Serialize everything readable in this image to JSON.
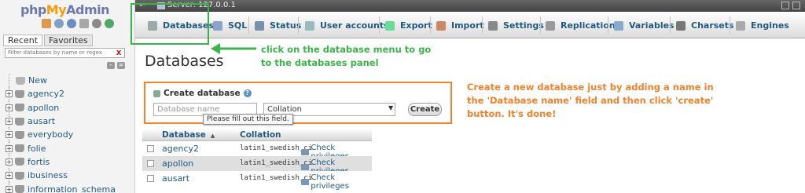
{
  "logo": {
    "part1": "php",
    "part2": "My",
    "part3": "Admin"
  },
  "nav": {
    "tabs": [
      "Recent",
      "Favorites"
    ],
    "filter_placeholder": "Filter databases by name or regex",
    "filter_clear": "X",
    "tree": [
      "New",
      "agency2",
      "apollon",
      "ausart",
      "everybody",
      "folie",
      "fortis",
      "ibusiness",
      "information_schema"
    ]
  },
  "topbar": {
    "back": "←",
    "server": "Server: 127.0.0.1"
  },
  "menu": {
    "tabs": [
      {
        "label": "Databases",
        "icon": "database-icon",
        "color": "#9aa"
      },
      {
        "label": "SQL",
        "icon": "sql-icon",
        "color": "#8aa4c8"
      },
      {
        "label": "Status",
        "icon": "status-icon",
        "color": "#7a8fa8"
      },
      {
        "label": "User accounts",
        "icon": "users-icon",
        "color": "#9bb"
      },
      {
        "label": "Export",
        "icon": "export-icon",
        "color": "#6d9"
      },
      {
        "label": "Import",
        "icon": "import-icon",
        "color": "#c86"
      },
      {
        "label": "Settings",
        "icon": "settings-icon",
        "color": "#888"
      },
      {
        "label": "Replication",
        "icon": "replication-icon",
        "color": "#999"
      },
      {
        "label": "Variables",
        "icon": "variables-icon",
        "color": "#8ac"
      },
      {
        "label": "Charsets",
        "icon": "charsets-icon",
        "color": "#777"
      },
      {
        "label": "Engines",
        "icon": "engines-icon",
        "color": "#aaa"
      }
    ]
  },
  "annotations": {
    "green": "click on the database menu to go to the databases panel",
    "orange": "Create a new database just by adding a name in the 'Database name' field and then click 'create' button. It's done!"
  },
  "page_title": "Databases",
  "create": {
    "heading": "Create database",
    "name_placeholder": "Database name",
    "collation": "Collation",
    "button": "Create",
    "tooltip": "Please fill out this field."
  },
  "table": {
    "headers": {
      "database": "Database",
      "collation": "Collation"
    },
    "rows": [
      {
        "name": "agency2",
        "collation": "latin1_swedish_ci",
        "priv": "Check privileges"
      },
      {
        "name": "apollon",
        "collation": "latin1_swedish_ci",
        "priv": "Check privileges"
      },
      {
        "name": "ausart",
        "collation": "latin1_swedish_ci",
        "priv": "Check privileges"
      }
    ]
  },
  "colors": {
    "annotation_green": "#3cb54a",
    "annotation_orange": "#f4822c",
    "link": "#235a81"
  }
}
